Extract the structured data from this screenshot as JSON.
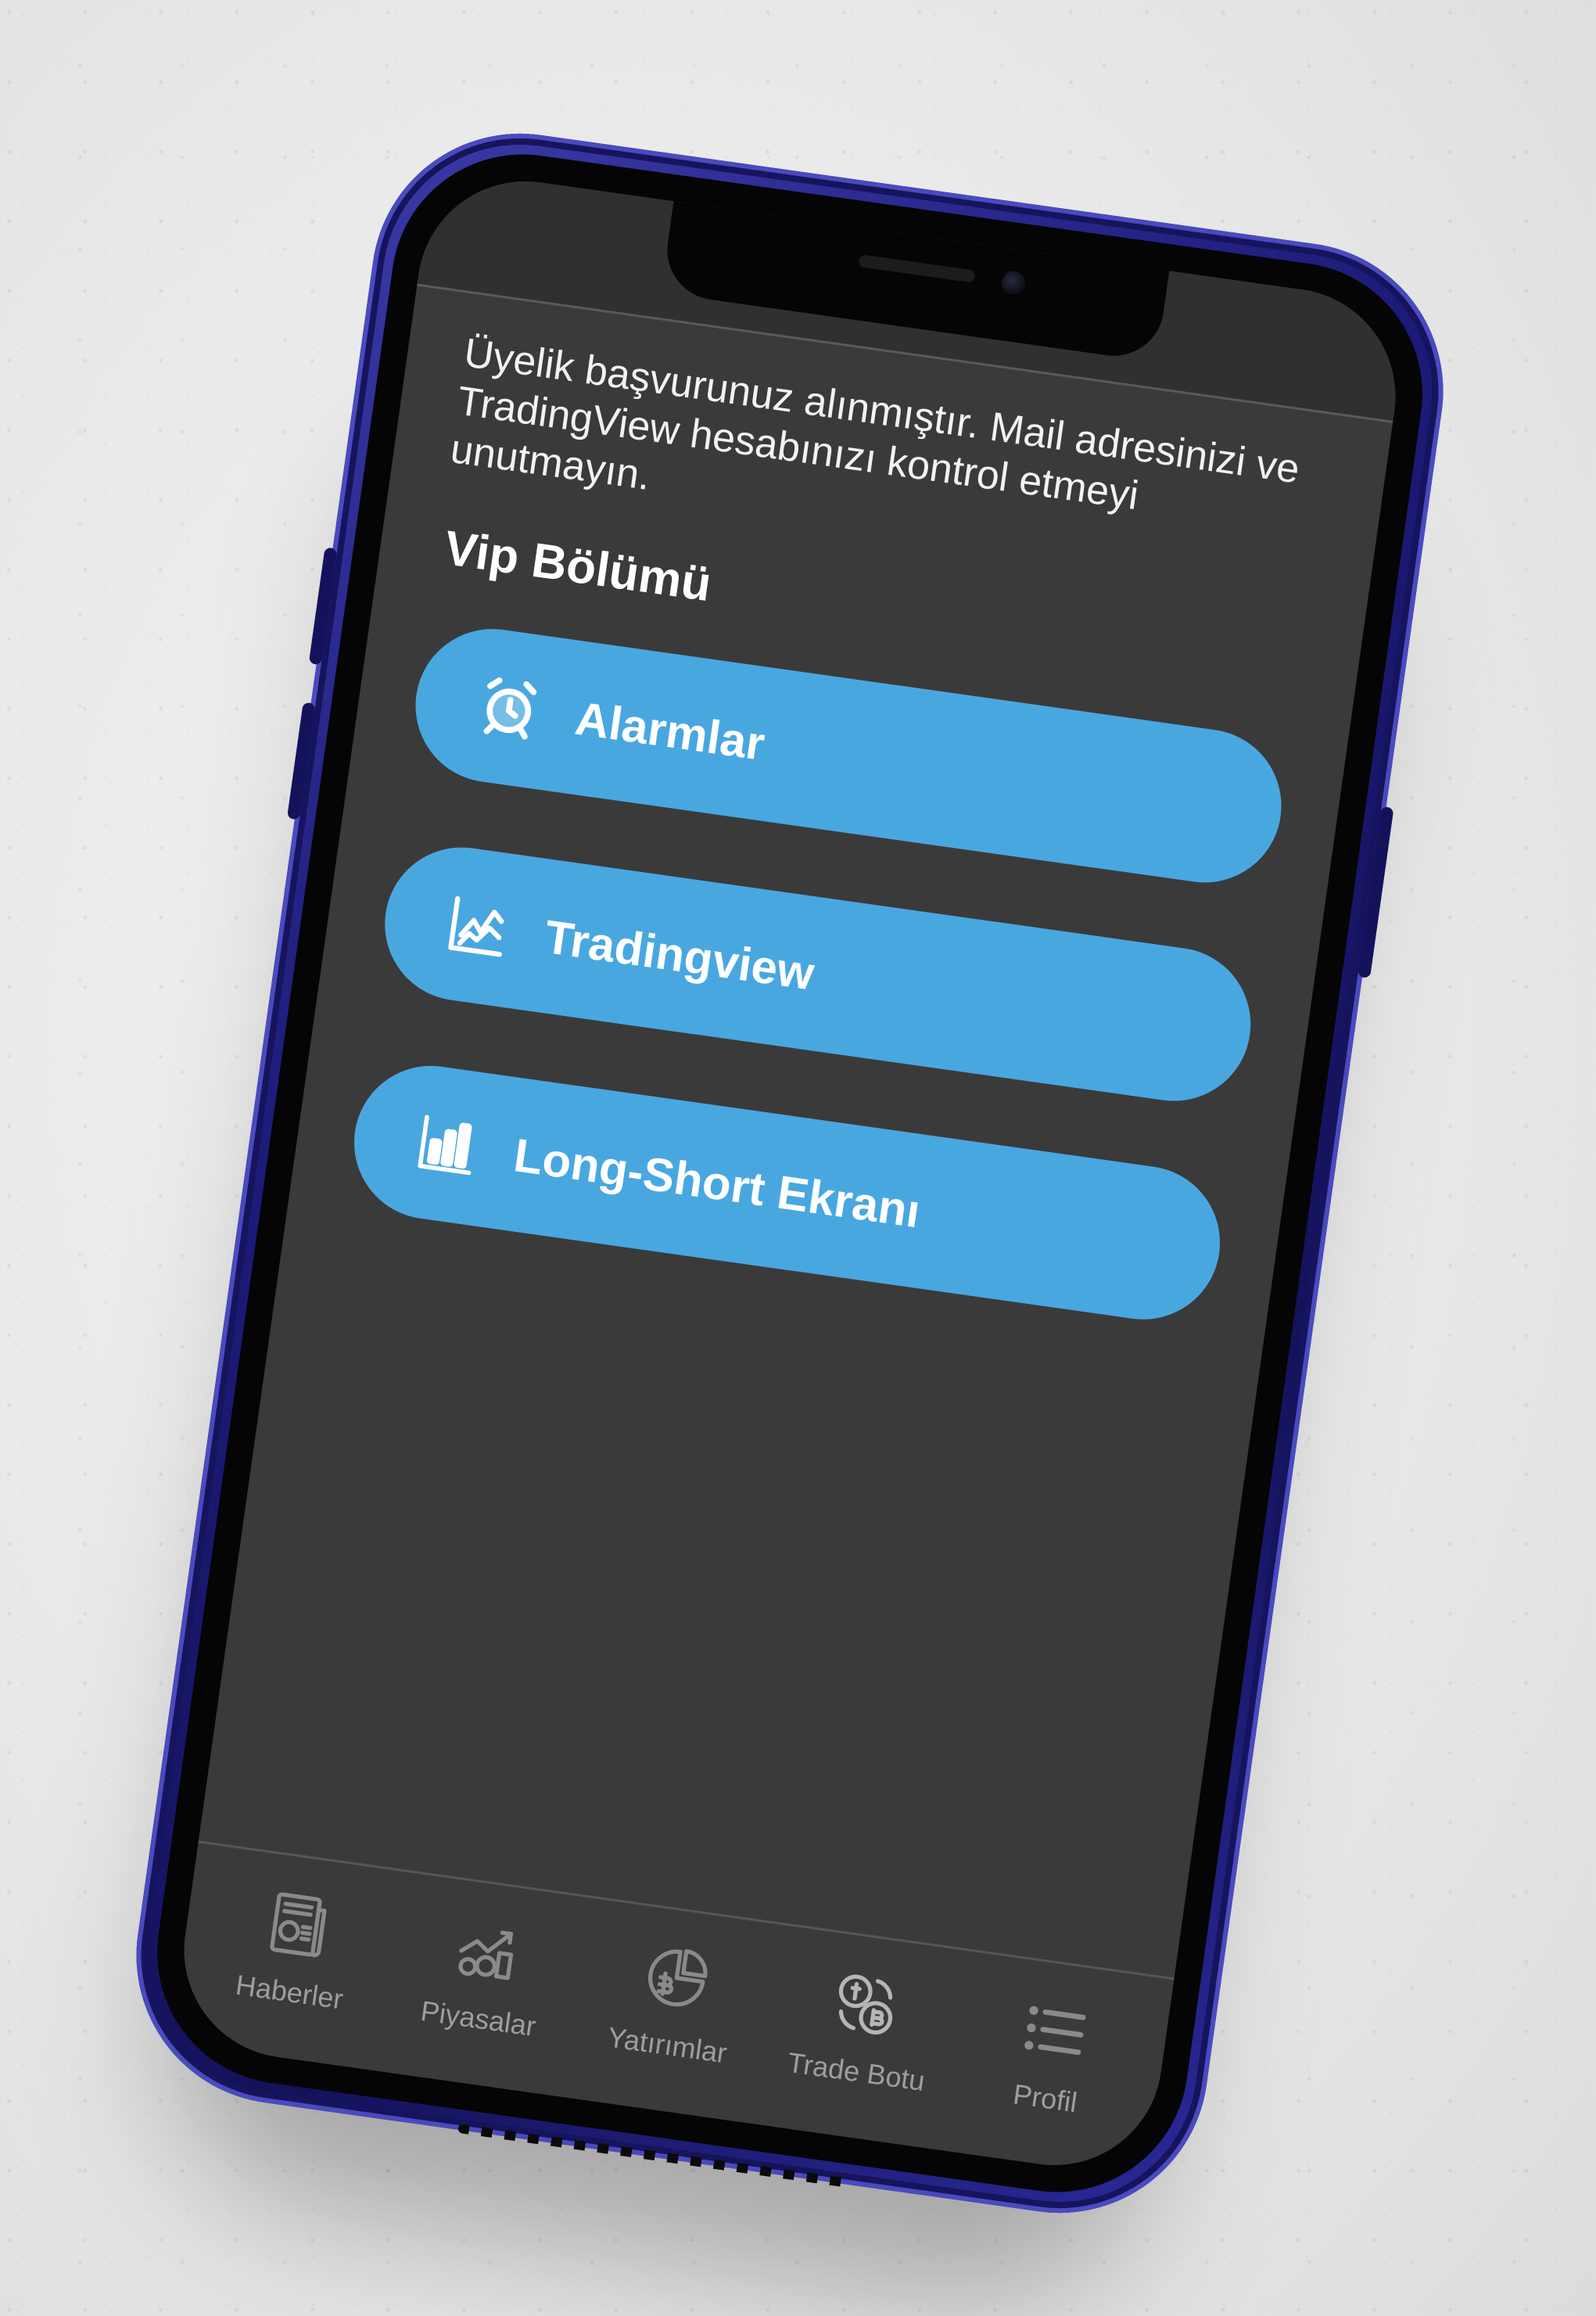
{
  "screen": {
    "message": "Üyelik başvurunuz alınmıştır. Mail adresinizi ve TradingView hesabınızı kontrol etmeyi unutmayın.",
    "section_title": "Vip Bölümü",
    "vip_buttons": [
      {
        "label": "Alarmlar",
        "icon": "alarm-clock-icon"
      },
      {
        "label": "Tradingview",
        "icon": "line-chart-icon"
      },
      {
        "label": "Long-Short Ekranı",
        "icon": "bar-chart-icon"
      }
    ]
  },
  "tabbar": {
    "items": [
      {
        "label": "Haberler",
        "icon": "newspaper-icon"
      },
      {
        "label": "Piyasalar",
        "icon": "market-growth-icon"
      },
      {
        "label": "Yatırımlar",
        "icon": "investment-pie-icon"
      },
      {
        "label": "Trade Botu",
        "icon": "coin-exchange-icon"
      },
      {
        "label": "Profil",
        "icon": "list-menu-icon"
      }
    ]
  },
  "colors": {
    "accent": "#49a7e0",
    "screen_bg": "#3a3a3a",
    "frame": "#1d1b78",
    "tab_label": "#9e9e9e"
  }
}
